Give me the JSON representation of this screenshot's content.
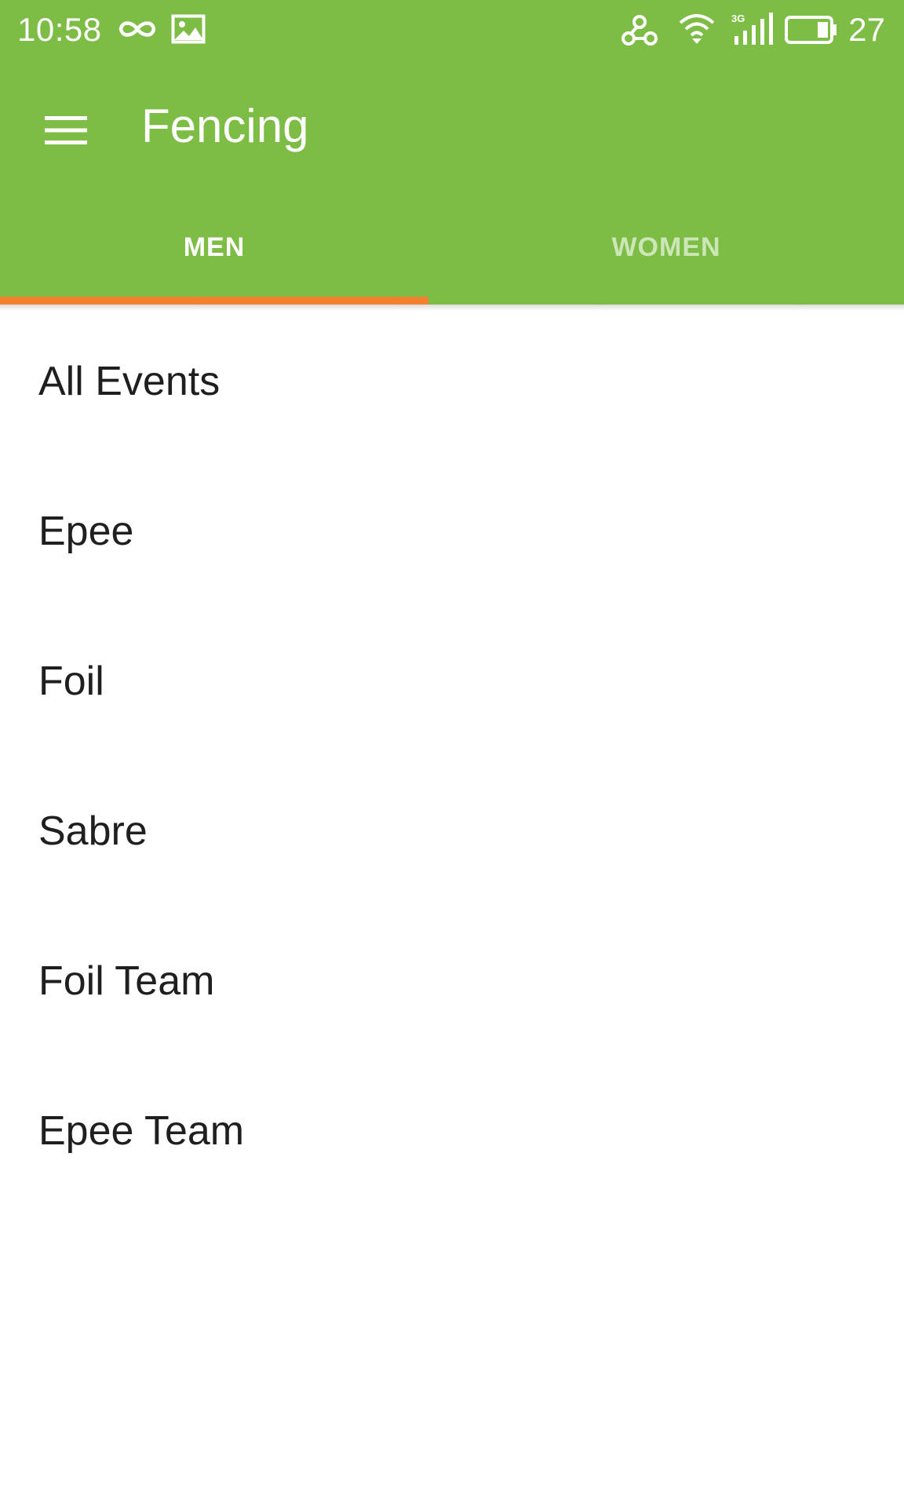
{
  "status_bar": {
    "time": "10:58",
    "battery_level": "27",
    "icons": [
      "infinity-icon",
      "image-icon",
      "shield-network-icon",
      "wifi-icon",
      "signal-3g-icon",
      "battery-icon"
    ]
  },
  "toolbar": {
    "title": "Fencing",
    "menu_icon": "hamburger-menu-icon"
  },
  "tabs": [
    {
      "label": "MEN",
      "active": true
    },
    {
      "label": "WOMEN",
      "active": false
    }
  ],
  "events": [
    {
      "label": "All Events"
    },
    {
      "label": "Epee"
    },
    {
      "label": "Foil"
    },
    {
      "label": "Sabre"
    },
    {
      "label": "Foil Team"
    },
    {
      "label": "Epee Team"
    }
  ],
  "colors": {
    "app_bar": "#7dbd46",
    "tab_indicator": "#f3802f",
    "text_primary": "#1f1f1f",
    "background": "#ffffff"
  }
}
